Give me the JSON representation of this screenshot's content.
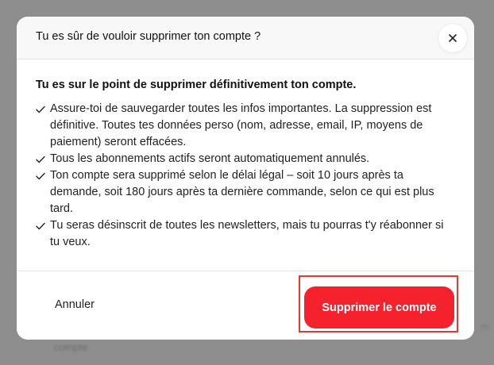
{
  "backdrop": {
    "text": "compte",
    "edge_text": "m"
  },
  "dialog": {
    "title": "Tu es sûr de vouloir supprimer ton compte ?",
    "close_icon": "close-icon",
    "lead": "Tu es sur le point de supprimer définitivement ton compte.",
    "items": [
      {
        "icon": "check-icon",
        "text": "Assure-toi de sauvegarder toutes les infos importantes. La suppression est définitive. Toutes tes données perso (nom, adresse, email, IP, moyens de paiement) seront effacées."
      },
      {
        "icon": "check-icon",
        "text": "Tous les abonnements actifs seront automatiquement annulés."
      },
      {
        "icon": "check-icon",
        "text": "Ton compte sera supprimé selon le délai légal – soit 10 jours après ta demande, soit 180 jours après ta dernière commande, selon ce qui est plus tard."
      },
      {
        "icon": "check-icon",
        "text": "Tu seras désinscrit de toutes les newsletters, mais tu pourras t'y réabonner si tu veux."
      }
    ],
    "cancel_label": "Annuler",
    "confirm_label": "Supprimer le compte"
  },
  "colors": {
    "overlay": "#8e8e8e",
    "header_bg": "#f8f8f8",
    "danger": "#f5222d",
    "highlight": "#e43a2a"
  }
}
